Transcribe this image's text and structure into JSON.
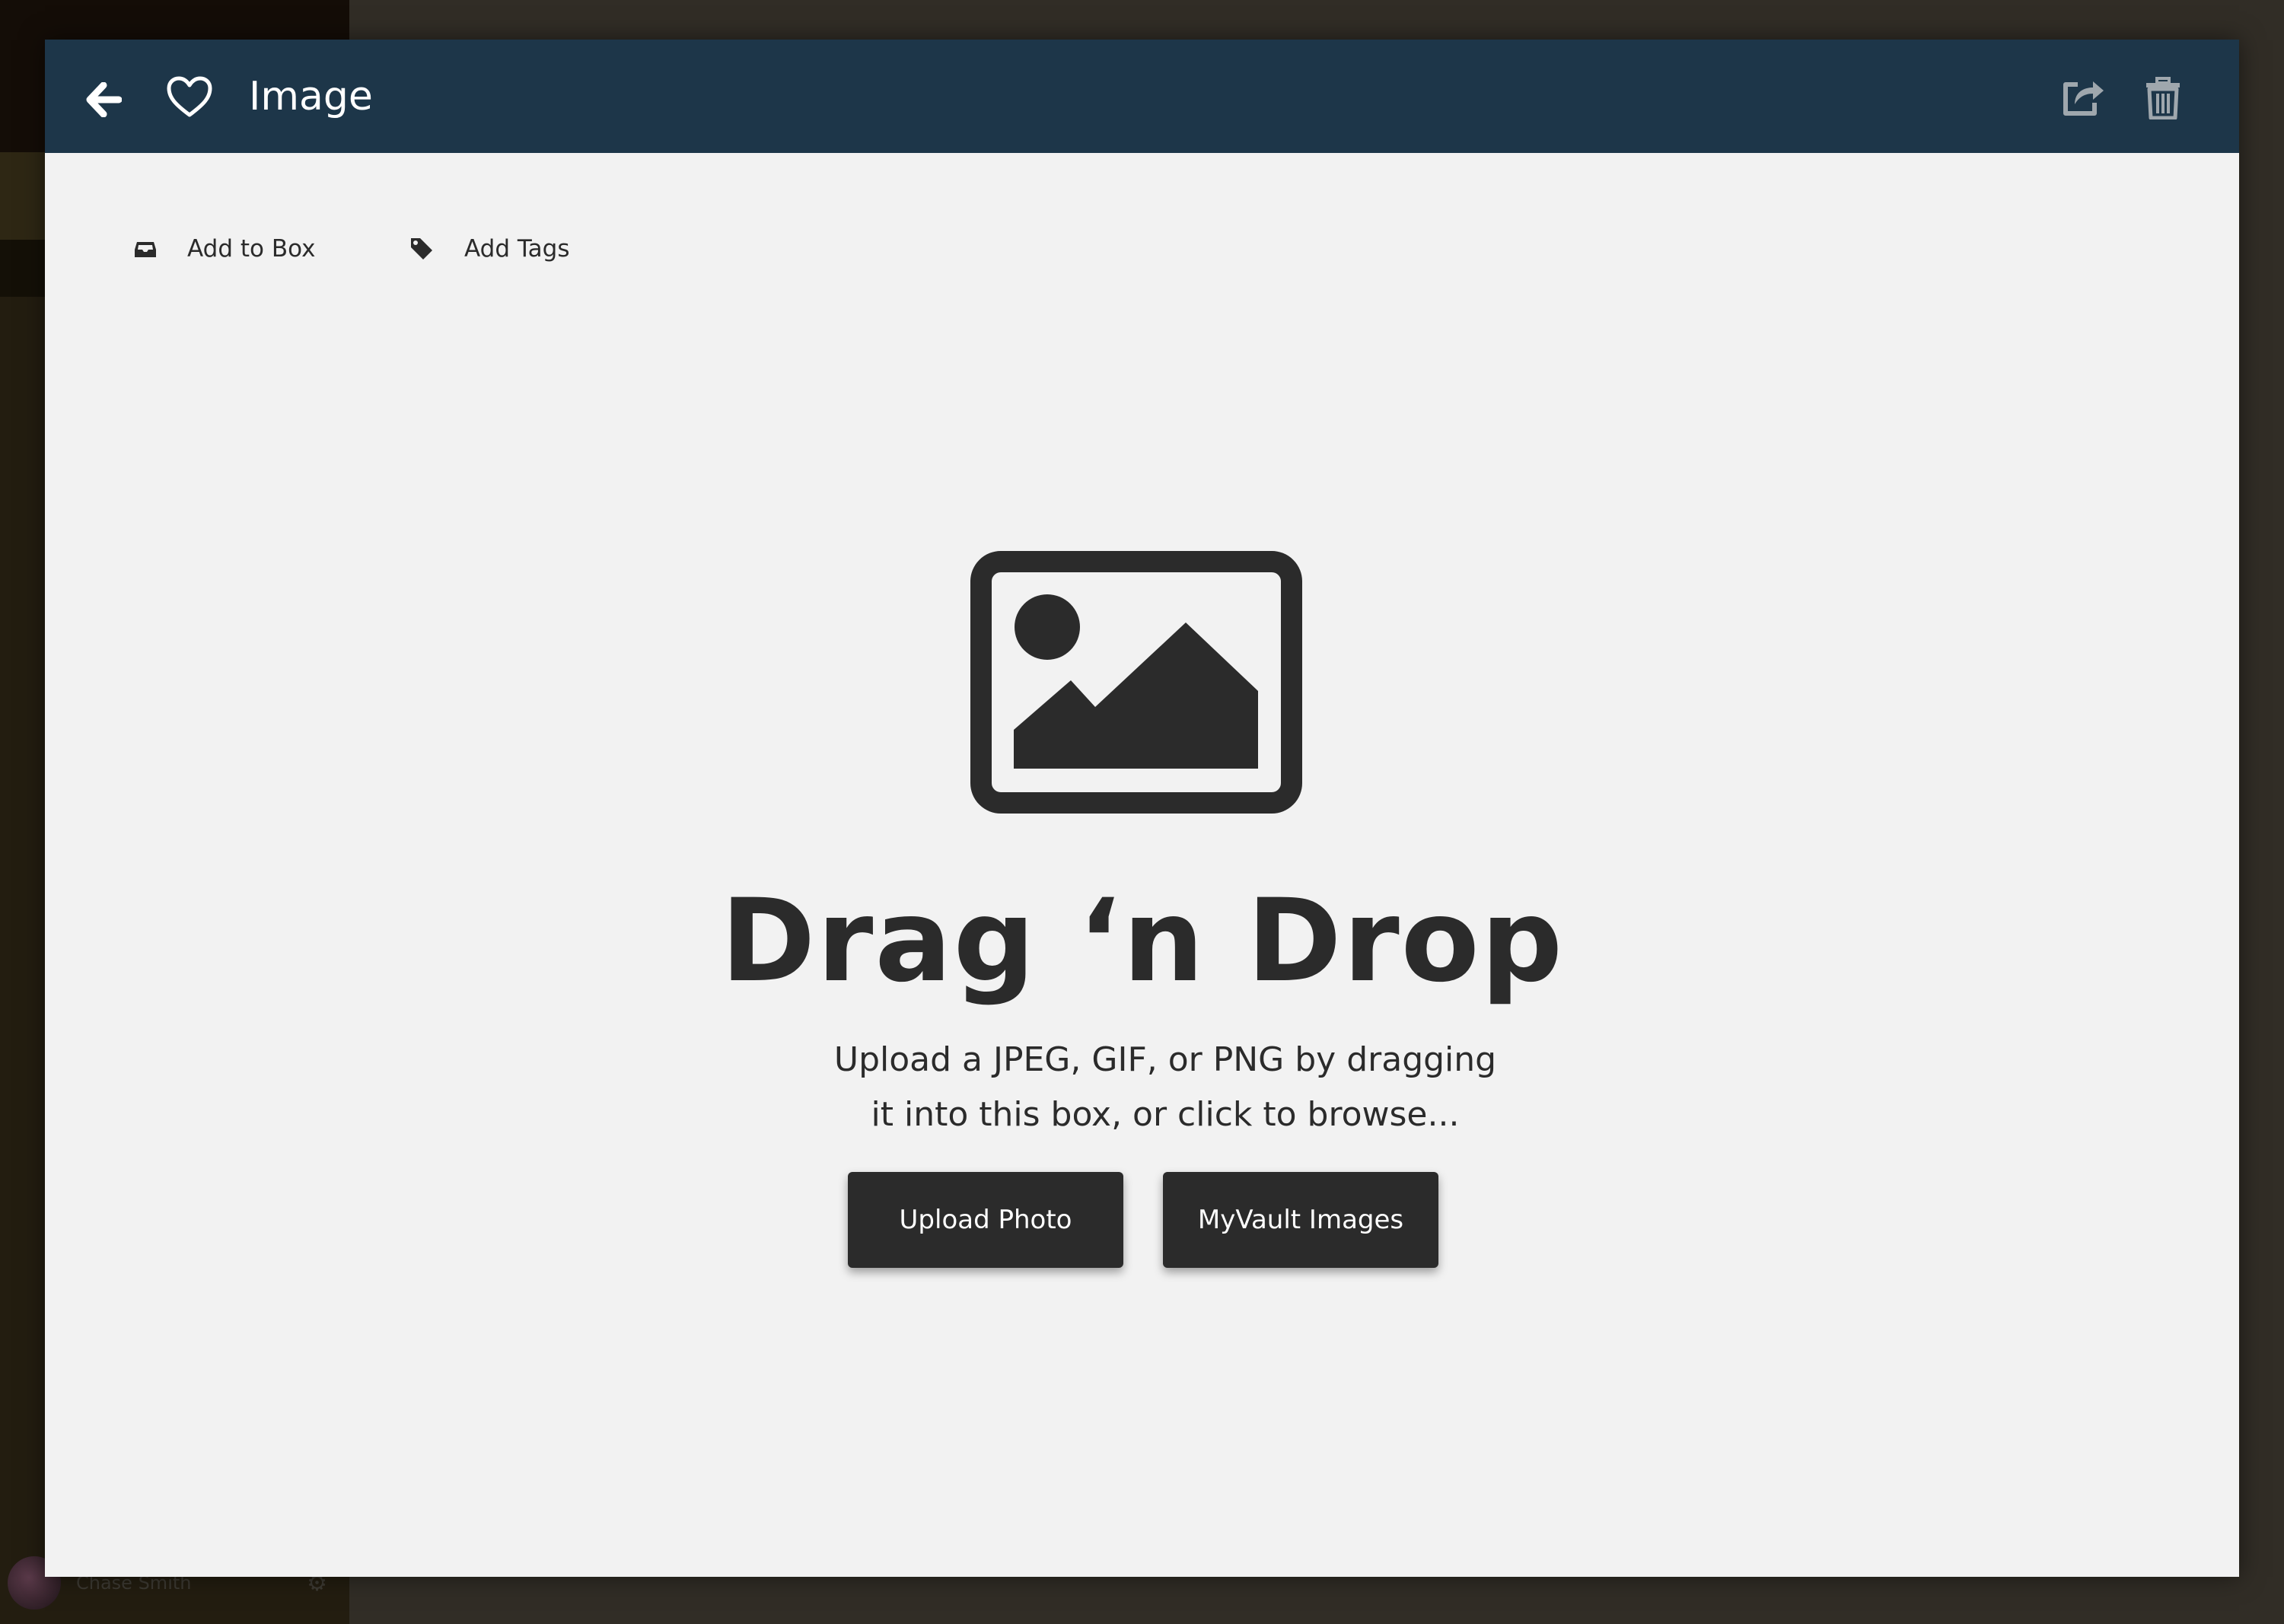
{
  "background": {
    "user_name": "Chase Smith",
    "gear_icon": "gear-icon"
  },
  "header": {
    "title": "Image",
    "back_icon": "arrow-left-icon",
    "favorite_icon": "heart-icon",
    "share_icon": "share-icon",
    "delete_icon": "trash-icon",
    "background_color": "#1d3649"
  },
  "toolbar": {
    "add_to_box": {
      "label": "Add to Box",
      "icon": "inbox-icon"
    },
    "add_tags": {
      "label": "Add Tags",
      "icon": "tag-icon"
    }
  },
  "drop_zone": {
    "icon": "image-placeholder-icon",
    "heading": "Drag ‘n Drop",
    "subtext_line1": "Upload a JPEG, GIF, or PNG by dragging",
    "subtext_line2": "it into this box, or click to browse...",
    "buttons": {
      "upload": "Upload Photo",
      "vault": "MyVault Images"
    }
  }
}
